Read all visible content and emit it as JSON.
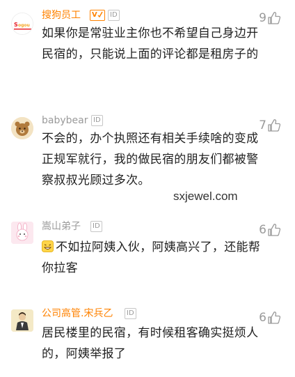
{
  "comments": [
    {
      "user": "搜狗员工",
      "avatar_text": "Sogou",
      "vip_label": "V",
      "id_badge": "ID",
      "likes": "9",
      "text": "如果你是常驻业主你也不希望自己身边开民宿的，只能说上面的评论都是租房子的"
    },
    {
      "user": "babybear",
      "id_badge": "ID",
      "likes": "7",
      "text": "不会的，办个执照还有相关手续啥的变成正规军就行，我的做民宿的朋友们都被警察叔叔光顾过多次。"
    },
    {
      "user": "嵩山弟子",
      "id_badge": "ID",
      "likes": "6",
      "text": "不如拉阿姨入伙，阿姨高兴了，还能帮你拉客"
    },
    {
      "user": "公司高管.宋兵乙",
      "id_badge": "ID",
      "likes": "6",
      "text": "居民楼里的民宿，有时候租客确实挺烦人的，阿姨举报了"
    }
  ],
  "watermark": "sxjewel.com",
  "colors": {
    "orange": "#ff8200",
    "gray": "#9a9a9a",
    "text": "#1f1f1f"
  },
  "icons": {
    "like": "thumb-up-icon",
    "vip": "vip-badge-icon",
    "emoji": "grin-emoji-icon"
  }
}
